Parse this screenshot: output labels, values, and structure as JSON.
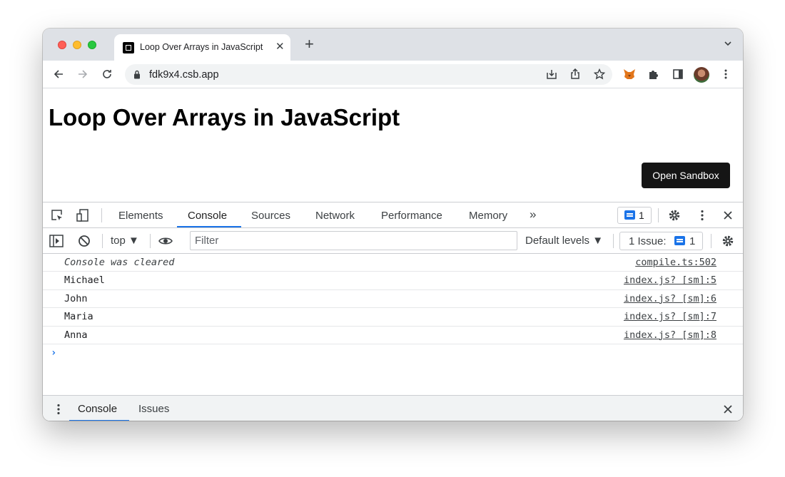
{
  "browser": {
    "tab_title": "Loop Over Arrays in JavaScript",
    "new_tab_symbol": "+",
    "url": "fdk9x4.csb.app"
  },
  "page": {
    "heading": "Loop Over Arrays in JavaScript",
    "open_sandbox_label": "Open Sandbox"
  },
  "devtools": {
    "tabs": [
      "Elements",
      "Console",
      "Sources",
      "Network",
      "Performance",
      "Memory"
    ],
    "active_tab": "Console",
    "more_tabs": "»",
    "messages_count": "1",
    "console_toolbar": {
      "context": "top ▼",
      "filter_placeholder": "Filter",
      "levels": "Default levels ▼",
      "issues_label": "1 Issue:",
      "issues_count": "1"
    },
    "log": [
      {
        "message": "Console was cleared",
        "source": "compile.ts:502"
      },
      {
        "message": "Michael",
        "source": "index.js? [sm]:5"
      },
      {
        "message": "John",
        "source": "index.js? [sm]:6"
      },
      {
        "message": "Maria",
        "source": "index.js? [sm]:7"
      },
      {
        "message": "Anna",
        "source": "index.js? [sm]:8"
      }
    ],
    "prompt_symbol": "›",
    "drawer_tabs": [
      "Console",
      "Issues"
    ]
  },
  "colors": {
    "accent": "#1a73e8",
    "tabstrip_bg": "#dee1e6",
    "button_bg": "#151515"
  }
}
